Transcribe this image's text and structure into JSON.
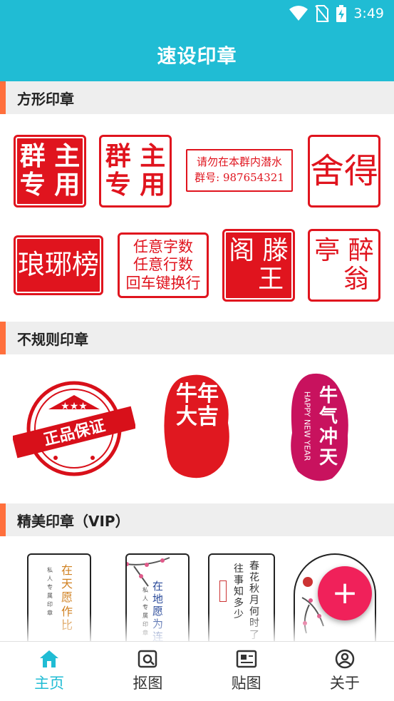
{
  "status_bar": {
    "time": "3:49",
    "icons": [
      "wifi-icon",
      "no-sim-icon",
      "battery-charging-icon"
    ]
  },
  "app_bar": {
    "title": "速设印章"
  },
  "sections": {
    "square": {
      "title": "方形印章"
    },
    "irregular": {
      "title": "不规则印章"
    },
    "vip": {
      "title": "精美印章（VIP）"
    }
  },
  "square_stamps": [
    {
      "text": "群 主\n专 用",
      "style": "solid"
    },
    {
      "text": "群 主\n专 用",
      "style": "outline"
    },
    {
      "text": "请勿在本群内潜水\n群号: 987654321",
      "style": "outline"
    },
    {
      "text": "舍得",
      "style": "outline"
    },
    {
      "text": "琅琊榜",
      "style": "solid"
    },
    {
      "text": "任意字数\n任意行数\n回车键换行",
      "style": "outline"
    },
    {
      "text": "阁 滕\n   王",
      "style": "solid"
    },
    {
      "text": "亭 醉\n   翁",
      "style": "outline"
    }
  ],
  "irregular_stamps": [
    {
      "text": "正品保证"
    },
    {
      "text": "牛年大吉"
    },
    {
      "text": "牛气冲天",
      "subtext": "HAPPY NEW YEAR"
    }
  ],
  "vip_cards": [
    {
      "text": "在天愿作比",
      "side": "私人专属印章"
    },
    {
      "text": "在地愿为连",
      "side": "私人专属印章"
    },
    {
      "text": "春花秋月何时了",
      "side": "往事知多少"
    },
    {
      "text": "",
      "side": ""
    }
  ],
  "fab": {
    "label": "+"
  },
  "bottom_nav": [
    {
      "label": "主页",
      "icon": "home-icon",
      "active": true
    },
    {
      "label": "抠图",
      "icon": "cutout-icon",
      "active": false
    },
    {
      "label": "贴图",
      "icon": "sticker-icon",
      "active": false
    },
    {
      "label": "关于",
      "icon": "user-icon",
      "active": false
    }
  ],
  "colors": {
    "primary": "#20bcd4",
    "accent": "#f0215a",
    "stamp_red": "#e0141e",
    "section_bar": "#ff6f3c"
  }
}
